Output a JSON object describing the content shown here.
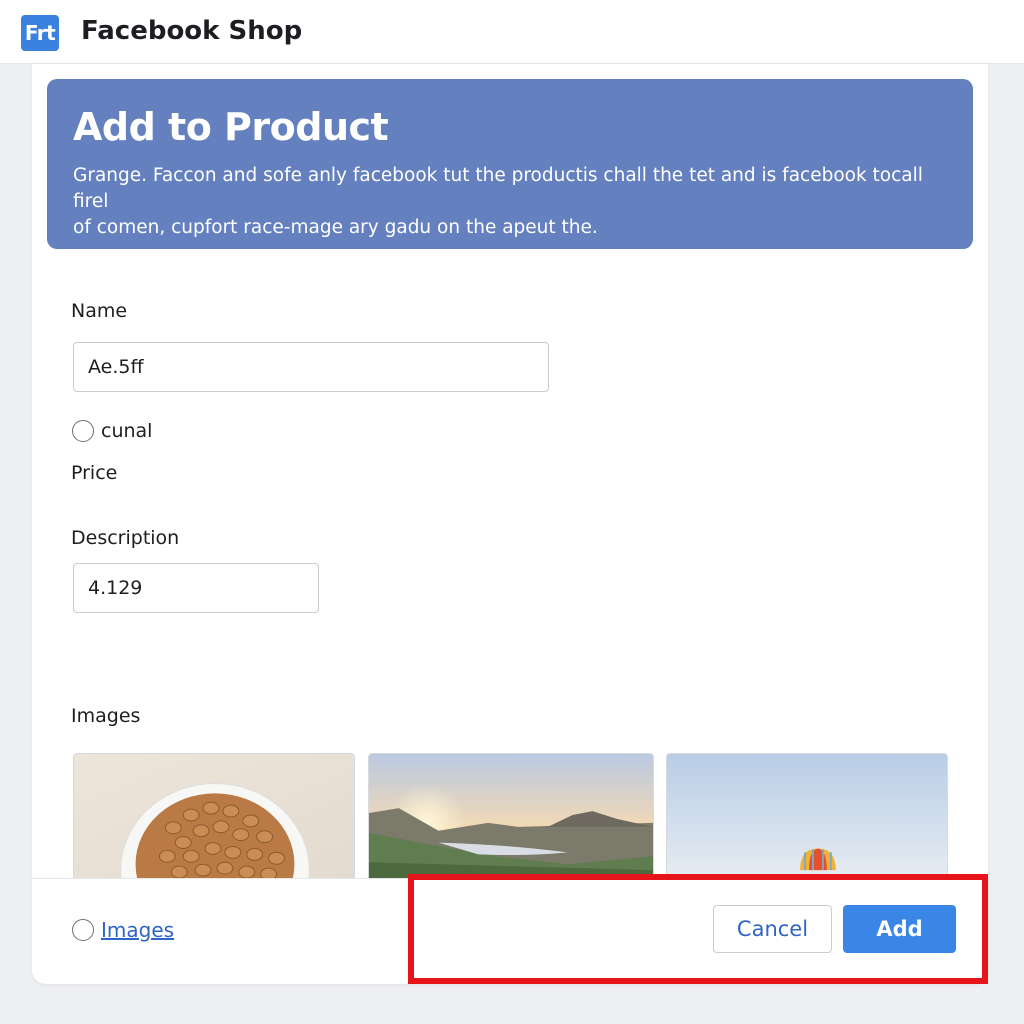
{
  "app": {
    "logo_text": "Frt",
    "title": "Facebook Shop"
  },
  "dialog": {
    "title": "Add to Product",
    "description_line1": "Grange. Faccon and sofe anly facebook tut the productis chall the tet and is facebook tocall firel",
    "description_line2": "of comen, cupfort race-mage ary gadu on the apeut the.",
    "banner_color": "#6480bf"
  },
  "form": {
    "name_label": "Name",
    "name_value": "Ae.5ff",
    "radio_option_label": "cunal",
    "price_label": "Price",
    "description_label": "Description",
    "description_value": "4.129",
    "images_label": "Images",
    "images": [
      {
        "icon": "bowl-of-nuts-image"
      },
      {
        "icon": "sunset-landscape-image"
      },
      {
        "icon": "hot-air-balloon-image"
      }
    ]
  },
  "footer": {
    "images_link": "Images",
    "cancel_label": "Cancel",
    "add_label": "Add",
    "add_color": "#3a86e6"
  },
  "highlight_color": "#e8141c"
}
